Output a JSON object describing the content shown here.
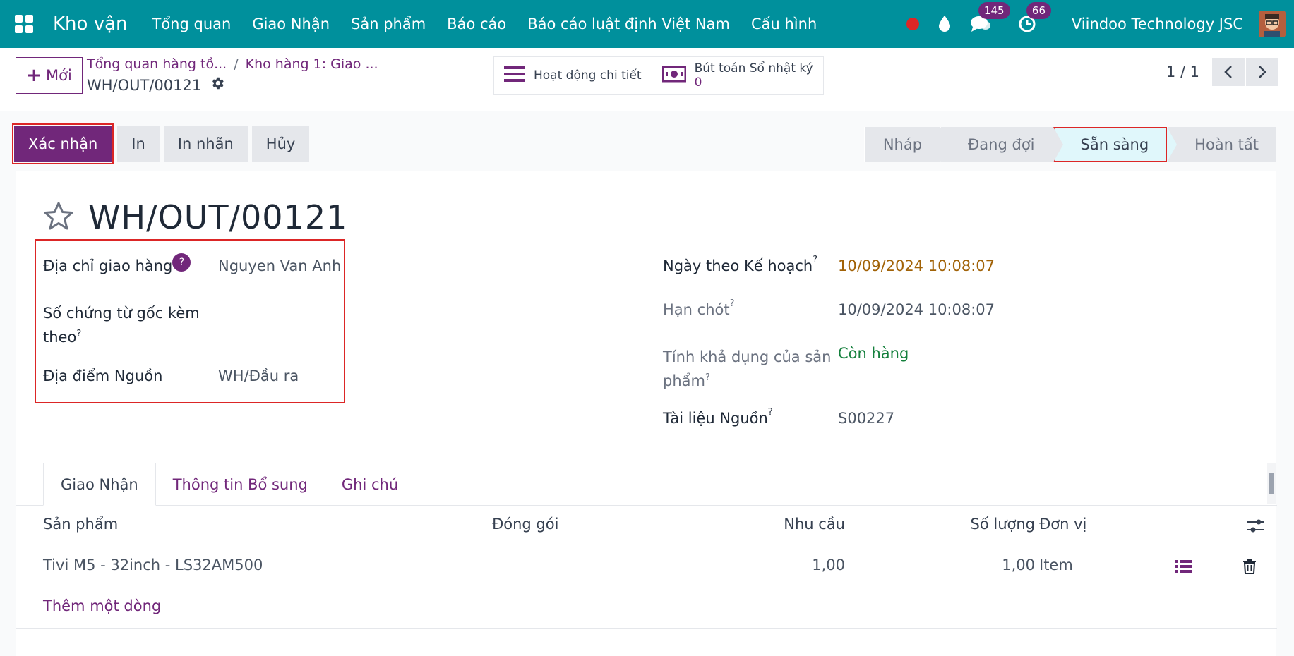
{
  "navbar": {
    "brand": "Kho vận",
    "menu": [
      "Tổng quan",
      "Giao Nhận",
      "Sản phẩm",
      "Báo cáo",
      "Báo cáo luật định Việt Nam",
      "Cấu hình"
    ],
    "messages_count": "145",
    "activities_count": "66",
    "company": "Viindoo Technology JSC",
    "colors": {
      "bar": "#00909c",
      "badge": "#71277a",
      "record": "#dc2626"
    }
  },
  "control": {
    "new_label": "Mới",
    "breadcrumb_1": "Tổng quan hàng tồ...",
    "breadcrumb_sep": "/",
    "breadcrumb_2": "Kho hàng 1: Giao ...",
    "current_record": "WH/OUT/00121",
    "smart_activity": "Hoạt động chi tiết",
    "smart_journal_label": "Bút toán Sổ nhật ký",
    "smart_journal_count": "0",
    "pager": "1 / 1"
  },
  "actions": {
    "confirm": "Xác nhận",
    "print": "In",
    "print_label": "In nhãn",
    "cancel": "Hủy"
  },
  "status": {
    "stages": [
      "Nháp",
      "Đang đợi",
      "Sẵn sàng",
      "Hoàn tất"
    ],
    "active": "Sẵn sàng"
  },
  "form": {
    "title": "WH/OUT/00121",
    "help_mark": "?",
    "sup_mark": "?",
    "left": {
      "delivery_address_label": "Địa chỉ giao hàng",
      "delivery_address_value": "Nguyen Van Anh",
      "origin_label_1": "Số chứng từ gốc kèm",
      "origin_label_2": "theo",
      "source_location_label": "Địa điểm Nguồn",
      "source_location_value": "WH/Đầu ra"
    },
    "right": {
      "scheduled_label": "Ngày theo Kế hoạch",
      "scheduled_value": "10/09/2024 10:08:07",
      "deadline_label": "Hạn chót",
      "deadline_value": "10/09/2024 10:08:07",
      "availability_label_1": "Tính khả dụng của sản",
      "availability_label_2": "phẩm",
      "availability_value": "Còn hàng",
      "source_doc_label": "Tài liệu Nguồn",
      "source_doc_value": "S00227"
    },
    "tabs": [
      "Giao Nhận",
      "Thông tin Bổ sung",
      "Ghi chú"
    ],
    "table": {
      "headers": {
        "product": "Sản phẩm",
        "package": "Đóng gói",
        "demand": "Nhu cầu",
        "quantity": "Số lượng",
        "uom": "Đơn vị"
      },
      "rows": [
        {
          "product": "Tivi M5 - 32inch - LS32AM500",
          "demand": "1,00",
          "quantity": "1,00",
          "uom": "Item"
        }
      ],
      "add_line": "Thêm một dòng"
    }
  }
}
